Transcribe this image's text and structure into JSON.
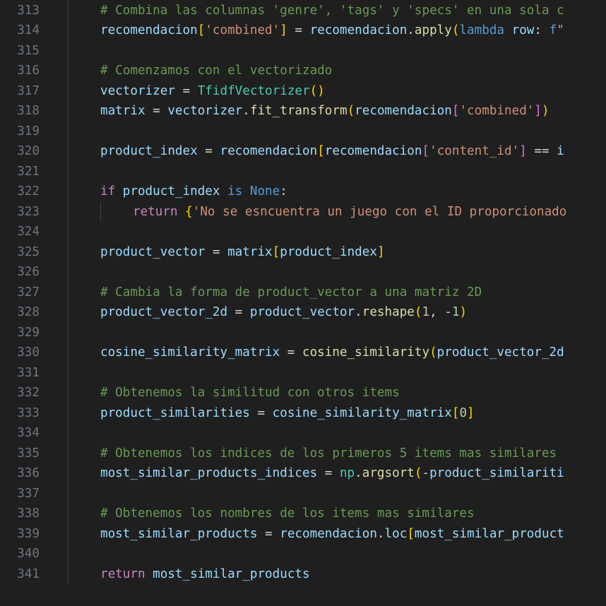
{
  "editor": {
    "first_line": 313,
    "lines": [
      {
        "n": "313",
        "indent": 0,
        "tokens": [
          [
            "comment",
            "# Combina las columnas 'genre', 'tags' y 'specs' en una sola c"
          ]
        ]
      },
      {
        "n": "314",
        "indent": 0,
        "tokens": [
          [
            "var",
            "recomendacion"
          ],
          [
            "b1",
            "["
          ],
          [
            "str",
            "'combined'"
          ],
          [
            "b1",
            "]"
          ],
          [
            "op",
            " = "
          ],
          [
            "var",
            "recomendacion"
          ],
          [
            "op",
            "."
          ],
          [
            "func",
            "apply"
          ],
          [
            "b1",
            "("
          ],
          [
            "kw",
            "lambda"
          ],
          [
            "op",
            " "
          ],
          [
            "var",
            "row"
          ],
          [
            "op",
            ": "
          ],
          [
            "kw",
            "f"
          ],
          [
            "str",
            "\""
          ]
        ]
      },
      {
        "n": "315",
        "indent": 0,
        "tokens": []
      },
      {
        "n": "316",
        "indent": 0,
        "tokens": [
          [
            "comment",
            "# Comenzamos con el vectorizado"
          ]
        ]
      },
      {
        "n": "317",
        "indent": 0,
        "tokens": [
          [
            "var",
            "vectorizer"
          ],
          [
            "op",
            " = "
          ],
          [
            "class",
            "TfidfVectorizer"
          ],
          [
            "b1",
            "()"
          ]
        ]
      },
      {
        "n": "318",
        "indent": 0,
        "tokens": [
          [
            "var",
            "matrix"
          ],
          [
            "op",
            " = "
          ],
          [
            "var",
            "vectorizer"
          ],
          [
            "op",
            "."
          ],
          [
            "func",
            "fit_transform"
          ],
          [
            "b1",
            "("
          ],
          [
            "var",
            "recomendacion"
          ],
          [
            "b2",
            "["
          ],
          [
            "str",
            "'combined'"
          ],
          [
            "b2",
            "]"
          ],
          [
            "b1",
            ")"
          ]
        ]
      },
      {
        "n": "319",
        "indent": 0,
        "tokens": []
      },
      {
        "n": "320",
        "indent": 0,
        "tokens": [
          [
            "var",
            "product_index"
          ],
          [
            "op",
            " = "
          ],
          [
            "var",
            "recomendacion"
          ],
          [
            "b1",
            "["
          ],
          [
            "var",
            "recomendacion"
          ],
          [
            "b2",
            "["
          ],
          [
            "str",
            "'content_id'"
          ],
          [
            "b2",
            "]"
          ],
          [
            "op",
            " == "
          ],
          [
            "var",
            "i"
          ]
        ]
      },
      {
        "n": "321",
        "indent": 0,
        "tokens": []
      },
      {
        "n": "322",
        "indent": 0,
        "tokens": [
          [
            "ctrl",
            "if"
          ],
          [
            "op",
            " "
          ],
          [
            "var",
            "product_index"
          ],
          [
            "op",
            " "
          ],
          [
            "kw",
            "is"
          ],
          [
            "op",
            " "
          ],
          [
            "kw",
            "None"
          ],
          [
            "op",
            ":"
          ]
        ]
      },
      {
        "n": "323",
        "indent": 1,
        "tokens": [
          [
            "ctrl",
            "return"
          ],
          [
            "op",
            " "
          ],
          [
            "b1",
            "{"
          ],
          [
            "str",
            "'No se esncuentra un juego con el ID proporcionado"
          ]
        ]
      },
      {
        "n": "324",
        "indent": 0,
        "tokens": []
      },
      {
        "n": "325",
        "indent": 0,
        "tokens": [
          [
            "var",
            "product_vector"
          ],
          [
            "op",
            " = "
          ],
          [
            "var",
            "matrix"
          ],
          [
            "b1",
            "["
          ],
          [
            "var",
            "product_index"
          ],
          [
            "b1",
            "]"
          ]
        ]
      },
      {
        "n": "326",
        "indent": 0,
        "tokens": []
      },
      {
        "n": "327",
        "indent": 0,
        "tokens": [
          [
            "comment",
            "# Cambia la forma de product_vector a una matriz 2D"
          ]
        ]
      },
      {
        "n": "328",
        "indent": 0,
        "tokens": [
          [
            "var",
            "product_vector_2d"
          ],
          [
            "op",
            " = "
          ],
          [
            "var",
            "product_vector"
          ],
          [
            "op",
            "."
          ],
          [
            "func",
            "reshape"
          ],
          [
            "b1",
            "("
          ],
          [
            "num",
            "1"
          ],
          [
            "op",
            ", -"
          ],
          [
            "num",
            "1"
          ],
          [
            "b1",
            ")"
          ]
        ]
      },
      {
        "n": "329",
        "indent": 0,
        "tokens": []
      },
      {
        "n": "330",
        "indent": 0,
        "tokens": [
          [
            "var",
            "cosine_similarity_matrix"
          ],
          [
            "op",
            " = "
          ],
          [
            "func",
            "cosine_similarity"
          ],
          [
            "b1",
            "("
          ],
          [
            "var",
            "product_vector_2d"
          ]
        ]
      },
      {
        "n": "331",
        "indent": 0,
        "tokens": []
      },
      {
        "n": "332",
        "indent": 0,
        "tokens": [
          [
            "comment",
            "# Obtenemos la similitud con otros items"
          ]
        ]
      },
      {
        "n": "333",
        "indent": 0,
        "tokens": [
          [
            "var",
            "product_similarities"
          ],
          [
            "op",
            " = "
          ],
          [
            "var",
            "cosine_similarity_matrix"
          ],
          [
            "b1",
            "["
          ],
          [
            "num",
            "0"
          ],
          [
            "b1",
            "]"
          ]
        ]
      },
      {
        "n": "334",
        "indent": 0,
        "tokens": []
      },
      {
        "n": "335",
        "indent": 0,
        "tokens": [
          [
            "comment",
            "# Obtenemos los indices de los primeros 5 items mas similares"
          ]
        ]
      },
      {
        "n": "336",
        "indent": 0,
        "tokens": [
          [
            "var",
            "most_similar_products_indices"
          ],
          [
            "op",
            " = "
          ],
          [
            "class",
            "np"
          ],
          [
            "op",
            "."
          ],
          [
            "func",
            "argsort"
          ],
          [
            "b1",
            "("
          ],
          [
            "op",
            "-"
          ],
          [
            "var",
            "product_similariti"
          ]
        ]
      },
      {
        "n": "337",
        "indent": 0,
        "tokens": []
      },
      {
        "n": "338",
        "indent": 0,
        "tokens": [
          [
            "comment",
            "# Obtenemos los nombres de los items mas similares"
          ]
        ]
      },
      {
        "n": "339",
        "indent": 0,
        "tokens": [
          [
            "var",
            "most_similar_products"
          ],
          [
            "op",
            " = "
          ],
          [
            "var",
            "recomendacion"
          ],
          [
            "op",
            "."
          ],
          [
            "var",
            "loc"
          ],
          [
            "b1",
            "["
          ],
          [
            "var",
            "most_similar_product"
          ]
        ]
      },
      {
        "n": "340",
        "indent": 0,
        "tokens": []
      },
      {
        "n": "341",
        "indent": 0,
        "tokens": [
          [
            "ctrl",
            "return"
          ],
          [
            "op",
            " "
          ],
          [
            "var",
            "most_similar_products"
          ]
        ]
      }
    ]
  },
  "colors": {
    "background": "#1f1f1f",
    "line_number": "#6e7681",
    "comment": "#6a9955",
    "variable": "#9cdcfe",
    "function": "#dcdcaa",
    "class": "#4ec9b0",
    "string": "#ce9178",
    "keyword": "#569cd6",
    "control": "#c586c0",
    "number": "#b5cea8",
    "bracket_1": "#ffd700",
    "bracket_2": "#da70d6"
  }
}
